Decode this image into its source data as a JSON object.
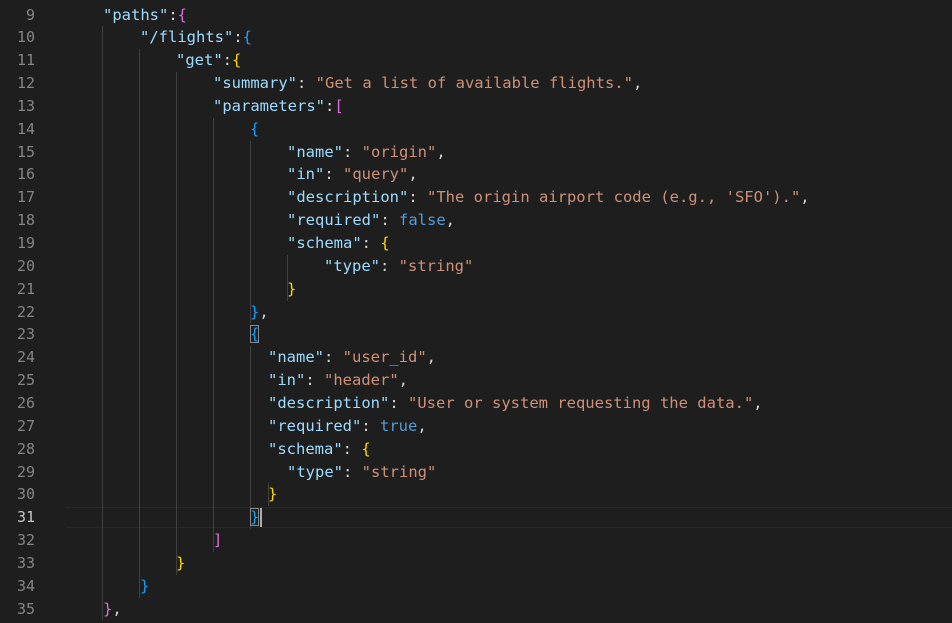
{
  "editor": {
    "active_line": "31",
    "lines": [
      {
        "num": "9",
        "tokens": [
          {
            "t": "\"paths\"",
            "c": "k"
          },
          {
            "t": ":",
            "c": "p"
          },
          {
            "t": "{",
            "c": "b2"
          }
        ]
      },
      {
        "num": "10",
        "tokens": [
          {
            "t": "\"/flights\"",
            "c": "k"
          },
          {
            "t": ":",
            "c": "p"
          },
          {
            "t": "{",
            "c": "b3"
          }
        ]
      },
      {
        "num": "11",
        "tokens": [
          {
            "t": "\"get\"",
            "c": "k"
          },
          {
            "t": ":",
            "c": "p"
          },
          {
            "t": "{",
            "c": "b1"
          }
        ]
      },
      {
        "num": "12",
        "tokens": [
          {
            "t": "\"summary\"",
            "c": "k"
          },
          {
            "t": ": ",
            "c": "p"
          },
          {
            "t": "\"Get a list of available flights.\"",
            "c": "s"
          },
          {
            "t": ",",
            "c": "p"
          }
        ]
      },
      {
        "num": "13",
        "tokens": [
          {
            "t": "\"parameters\"",
            "c": "k"
          },
          {
            "t": ":",
            "c": "p"
          },
          {
            "t": "[",
            "c": "b2"
          }
        ]
      },
      {
        "num": "14",
        "tokens": [
          {
            "t": "{",
            "c": "b3"
          }
        ]
      },
      {
        "num": "15",
        "tokens": [
          {
            "t": "\"name\"",
            "c": "k"
          },
          {
            "t": ": ",
            "c": "p"
          },
          {
            "t": "\"origin\"",
            "c": "s"
          },
          {
            "t": ",",
            "c": "p"
          }
        ]
      },
      {
        "num": "16",
        "tokens": [
          {
            "t": "\"in\"",
            "c": "k"
          },
          {
            "t": ": ",
            "c": "p"
          },
          {
            "t": "\"query\"",
            "c": "s"
          },
          {
            "t": ",",
            "c": "p"
          }
        ]
      },
      {
        "num": "17",
        "tokens": [
          {
            "t": "\"description\"",
            "c": "k"
          },
          {
            "t": ": ",
            "c": "p"
          },
          {
            "t": "\"The origin airport code (e.g., 'SFO').\"",
            "c": "s"
          },
          {
            "t": ",",
            "c": "p"
          }
        ]
      },
      {
        "num": "18",
        "tokens": [
          {
            "t": "\"required\"",
            "c": "k"
          },
          {
            "t": ": ",
            "c": "p"
          },
          {
            "t": "false",
            "c": "kw"
          },
          {
            "t": ",",
            "c": "p"
          }
        ]
      },
      {
        "num": "19",
        "tokens": [
          {
            "t": "\"schema\"",
            "c": "k"
          },
          {
            "t": ": ",
            "c": "p"
          },
          {
            "t": "{",
            "c": "b1"
          }
        ]
      },
      {
        "num": "20",
        "tokens": [
          {
            "t": "\"type\"",
            "c": "k"
          },
          {
            "t": ": ",
            "c": "p"
          },
          {
            "t": "\"string\"",
            "c": "s"
          }
        ]
      },
      {
        "num": "21",
        "tokens": [
          {
            "t": "}",
            "c": "b1"
          }
        ]
      },
      {
        "num": "22",
        "tokens": [
          {
            "t": "}",
            "c": "b3"
          },
          {
            "t": ",",
            "c": "p"
          }
        ]
      },
      {
        "num": "23",
        "tokens": [
          {
            "t": "{",
            "c": "b3 bm"
          }
        ]
      },
      {
        "num": "24",
        "tokens": [
          {
            "t": "\"name\"",
            "c": "k"
          },
          {
            "t": ": ",
            "c": "p"
          },
          {
            "t": "\"user_id\"",
            "c": "s"
          },
          {
            "t": ",",
            "c": "p"
          }
        ]
      },
      {
        "num": "25",
        "tokens": [
          {
            "t": "\"in\"",
            "c": "k"
          },
          {
            "t": ": ",
            "c": "p"
          },
          {
            "t": "\"header\"",
            "c": "s"
          },
          {
            "t": ",",
            "c": "p"
          }
        ]
      },
      {
        "num": "26",
        "tokens": [
          {
            "t": "\"description\"",
            "c": "k"
          },
          {
            "t": ": ",
            "c": "p"
          },
          {
            "t": "\"User or system requesting the data.\"",
            "c": "s"
          },
          {
            "t": ",",
            "c": "p"
          }
        ]
      },
      {
        "num": "27",
        "tokens": [
          {
            "t": "\"required\"",
            "c": "k"
          },
          {
            "t": ": ",
            "c": "p"
          },
          {
            "t": "true",
            "c": "kw"
          },
          {
            "t": ",",
            "c": "p"
          }
        ]
      },
      {
        "num": "28",
        "tokens": [
          {
            "t": "\"schema\"",
            "c": "k"
          },
          {
            "t": ": ",
            "c": "p"
          },
          {
            "t": "{",
            "c": "b1"
          }
        ]
      },
      {
        "num": "29",
        "tokens": [
          {
            "t": "\"type\"",
            "c": "k"
          },
          {
            "t": ": ",
            "c": "p"
          },
          {
            "t": "\"string\"",
            "c": "s"
          }
        ]
      },
      {
        "num": "30",
        "tokens": [
          {
            "t": "}",
            "c": "b1"
          }
        ]
      },
      {
        "num": "31",
        "tokens": [
          {
            "t": "}",
            "c": "b3 bm"
          }
        ]
      },
      {
        "num": "32",
        "tokens": [
          {
            "t": "]",
            "c": "b2"
          }
        ]
      },
      {
        "num": "33",
        "tokens": [
          {
            "t": "}",
            "c": "b1"
          }
        ]
      },
      {
        "num": "34",
        "tokens": [
          {
            "t": "}",
            "c": "b3"
          }
        ]
      },
      {
        "num": "35",
        "tokens": [
          {
            "t": "}",
            "c": "b2"
          },
          {
            "t": ",",
            "c": "p"
          }
        ]
      }
    ]
  },
  "colors": {
    "background": "#1e1e1e",
    "line_number": "#858585",
    "property_key": "#9cdcfe",
    "string_value": "#ce9178",
    "keyword": "#569cd6",
    "bracket_gold": "#ffd700",
    "bracket_orchid": "#da70d6",
    "bracket_blue": "#179fff"
  }
}
